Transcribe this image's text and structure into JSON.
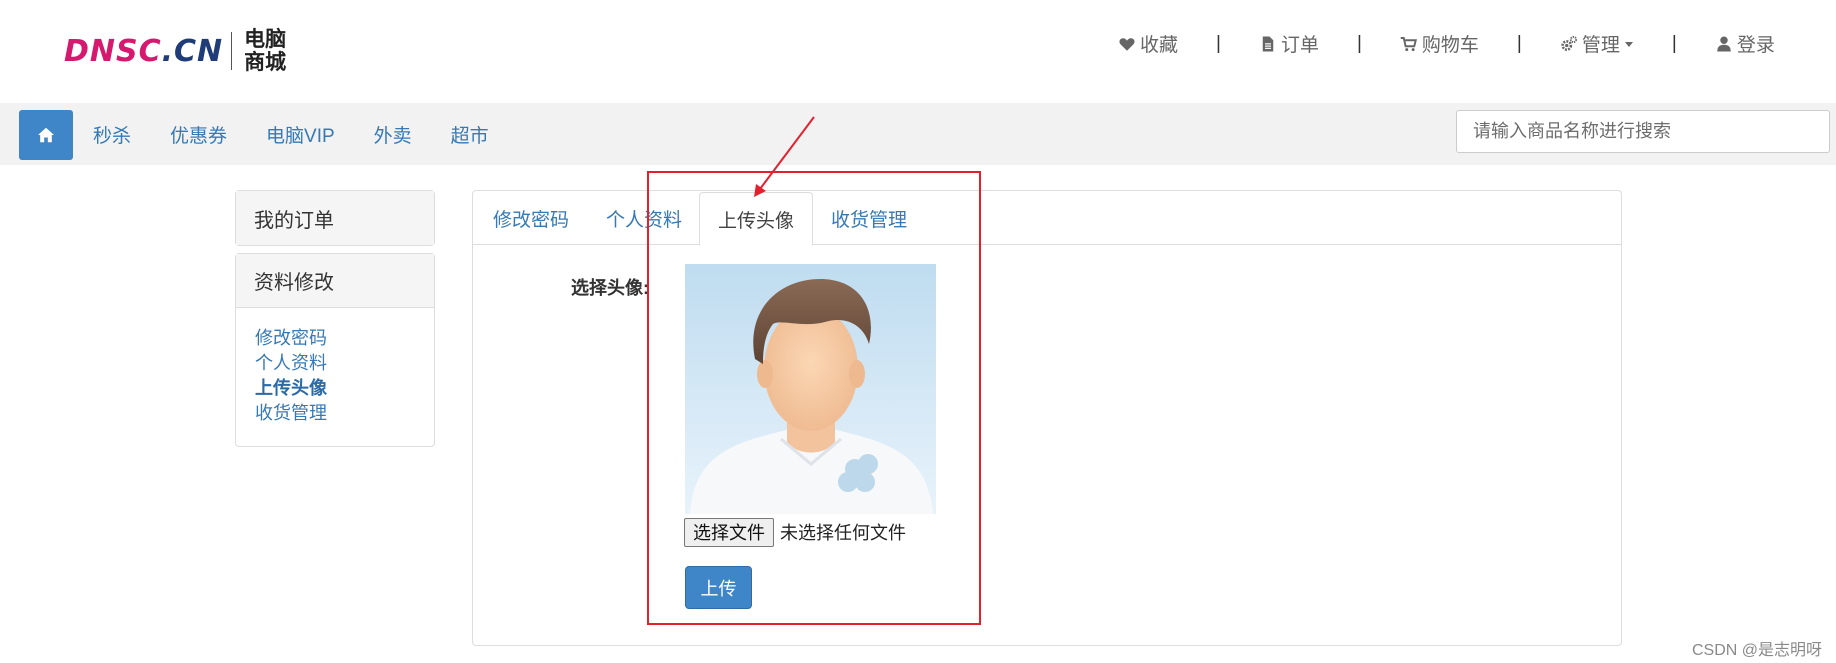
{
  "header": {
    "logo": {
      "latin_part1": "DNSC",
      "latin_part2": ".CN",
      "cn_line1": "电脑",
      "cn_line2": "商城"
    },
    "links": [
      {
        "label": "收藏",
        "icon": "heart-icon"
      },
      {
        "label": "订单",
        "icon": "file-text-icon"
      },
      {
        "label": "购物车",
        "icon": "cart-icon"
      },
      {
        "label": "管理",
        "icon": "gears-icon"
      },
      {
        "label": "登录",
        "icon": "user-icon"
      }
    ],
    "separator": "|"
  },
  "navbar": {
    "home_icon": "home-icon",
    "links": [
      "秒杀",
      "优惠券",
      "电脑VIP",
      "外卖",
      "超市"
    ],
    "search_placeholder": "请输入商品名称进行搜索"
  },
  "sidebar": {
    "panel1_title": "我的订单",
    "panel2_title": "资料修改",
    "items": [
      {
        "label": "修改密码"
      },
      {
        "label": "个人资料"
      },
      {
        "label": "上传头像",
        "active": true
      },
      {
        "label": "收货管理"
      }
    ]
  },
  "main": {
    "tabs": [
      "修改密码",
      "个人资料",
      "上传头像",
      "收货管理"
    ],
    "active_tab": "上传头像",
    "field_label": "选择头像:",
    "file_button": "选择文件",
    "file_status": "未选择任何文件",
    "upload_button": "上传"
  },
  "watermark": "CSDN @是志明呀",
  "colors": {
    "accent": "#3f86c8",
    "link": "#3679b5",
    "annotation": "#e5202e",
    "brand_pink": "#d6186e",
    "brand_navy": "#1f3b78"
  }
}
